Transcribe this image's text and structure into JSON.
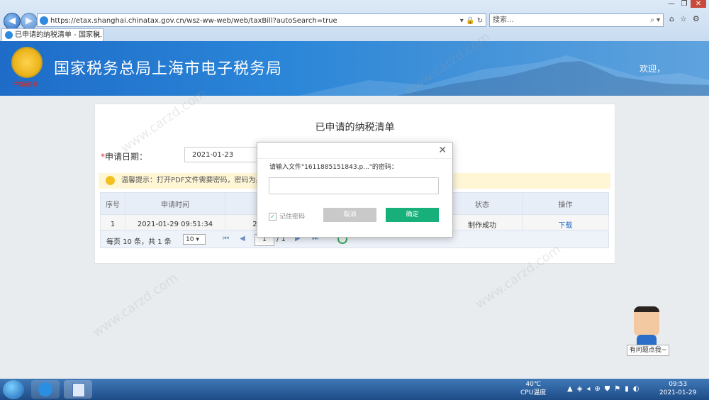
{
  "browser": {
    "url": "https://etax.shanghai.chinatax.gov.cn/wsz-ww-web/web/taxBill?autoSearch=true",
    "search_placeholder": "搜索...",
    "tab_title": "已申请的纳税清单 - 国家税...",
    "tab_close": "×"
  },
  "banner": {
    "title": "国家税务总局上海市电子税务局",
    "emblem_caption": "中国税务",
    "welcome": "欢迎，"
  },
  "page": {
    "title": "已申请的纳税清单",
    "date_required_mark": "*",
    "date_label": "申请日期：",
    "date_value": "2021-01-23",
    "tip": "温馨提示：打开PDF文件需要密码，密码为身份证件"
  },
  "table": {
    "headers": [
      "序号",
      "申请时间",
      "税",
      "",
      "状态",
      "操作"
    ],
    "rows": [
      [
        "1",
        "2021-01-29 09:51:34",
        "2018",
        "",
        "制作成功",
        "下载"
      ]
    ]
  },
  "pager": {
    "summary": "每页 10 条，共 1 条",
    "page_size": "10 ▾",
    "first": "⏮",
    "prev": "◀",
    "current_page": "1",
    "of_total": "/ 1",
    "next": "▶",
    "last": "⏭"
  },
  "dialog": {
    "prompt": "请输入文件\"1611885151843.p...\"的密码：",
    "close": "✕",
    "remember_label": "记住密码",
    "remember_checked": "✓",
    "cancel_label": "取消",
    "ok_label": "确定"
  },
  "help": {
    "label": "有问题点我~"
  },
  "taskbar": {
    "cpu_temp": "40℃",
    "cpu_label": "CPU温度",
    "time": "09:53",
    "date": "2021-01-29"
  },
  "watermark": "www.carzd.com",
  "colors": {
    "banner": "#2b86d8",
    "ok_button": "#18b07a",
    "link": "#2a6ec9"
  }
}
